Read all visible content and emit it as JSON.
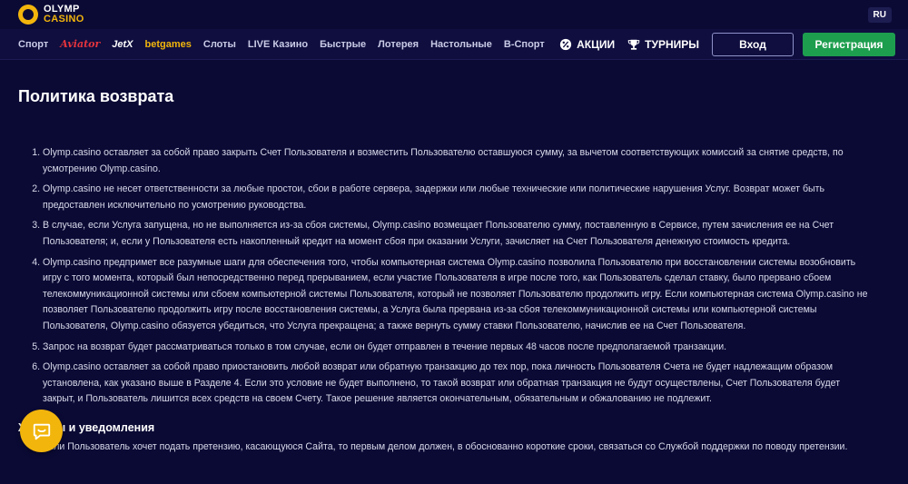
{
  "header": {
    "logo_line1": "OLYMP",
    "logo_line2": "CASINO",
    "lang": "RU"
  },
  "nav": {
    "items": [
      "Спорт",
      "Aviator",
      "JetX",
      "betgames",
      "Слоты",
      "LIVE Казино",
      "Быстрые",
      "Лотерея",
      "Настольные",
      "В-Спорт"
    ],
    "promos_label": "АКЦИИ",
    "tournaments_label": "ТУРНИРЫ",
    "login_label": "Вход",
    "register_label": "Регистрация"
  },
  "colors": {
    "background": "#0b0a35",
    "accent_yellow": "#f2b50c",
    "register_green": "#1d9e4e",
    "aviator_red": "#e4343d"
  },
  "page": {
    "title": "Политика возврата",
    "rules": [
      "Olymp.casino оставляет за собой право закрыть Счет Пользователя и возместить Пользователю оставшуюся сумму, за вычетом соответствующих комиссий за снятие средств, по усмотрению Olymp.casino.",
      "Olymp.casino не несет ответственности за любые простои, сбои в работе сервера, задержки или любые технические или политические нарушения Услуг. Возврат может быть предоставлен исключительно по усмотрению руководства.",
      "В случае, если Услуга запущена, но не выполняется из-за сбоя системы, Olymp.casino возмещает Пользователю сумму, поставленную в Сервисе, путем зачисления ее на Счет Пользователя; и, если у Пользователя есть накопленный кредит на момент сбоя при оказании Услуги, зачисляет на Счет Пользователя денежную стоимость кредита.",
      "Olymp.casino предпримет все разумные шаги для обеспечения того, чтобы компьютерная система Olymp.casino позволила Пользователю при восстановлении системы возобновить игру с того момента, который был непосредственно перед прерыванием, если участие Пользователя в игре после того, как Пользователь сделал ставку, было прервано сбоем телекоммуникационной системы или сбоем компьютерной системы Пользователя, который не позволяет Пользователю продолжить игру. Если компьютерная система Olymp.casino не позволяет Пользователю продолжить игру после восстановления системы, а Услуга была прервана из-за сбоя телекоммуникационной системы или компьютерной системы Пользователя, Olymp.casino обязуется убедиться, что Услуга прекращена; а также вернуть сумму ставки Пользователю, начислив ее на Счет Пользователя.",
      "Запрос на возврат будет рассматриваться только в том случае, если он будет отправлен в течение первых 48 часов после предполагаемой транзакции.",
      "Olymp.casino оставляет за собой право приостановить любой возврат или обратную транзакцию до тех пор, пока личность Пользователя Счета не будет надлежащим образом установлена, как указано выше в Разделе 4. Если это условие не будет выполнено, то такой возврат или обратная транзакция не будут осуществлены, Счет Пользователя будет закрыт, и Пользователь лишится всех средств на своем Счету. Такое решение является окончательным, обязательным и обжалованию не подлежит."
    ],
    "claims_heading": "Жалобы и уведомления",
    "claims": [
      "Если Пользователь хочет подать претензию, касающуюся Сайта, то первым делом должен, в обоснованно короткие сроки, связаться со Службой поддержки по поводу претензии."
    ]
  }
}
